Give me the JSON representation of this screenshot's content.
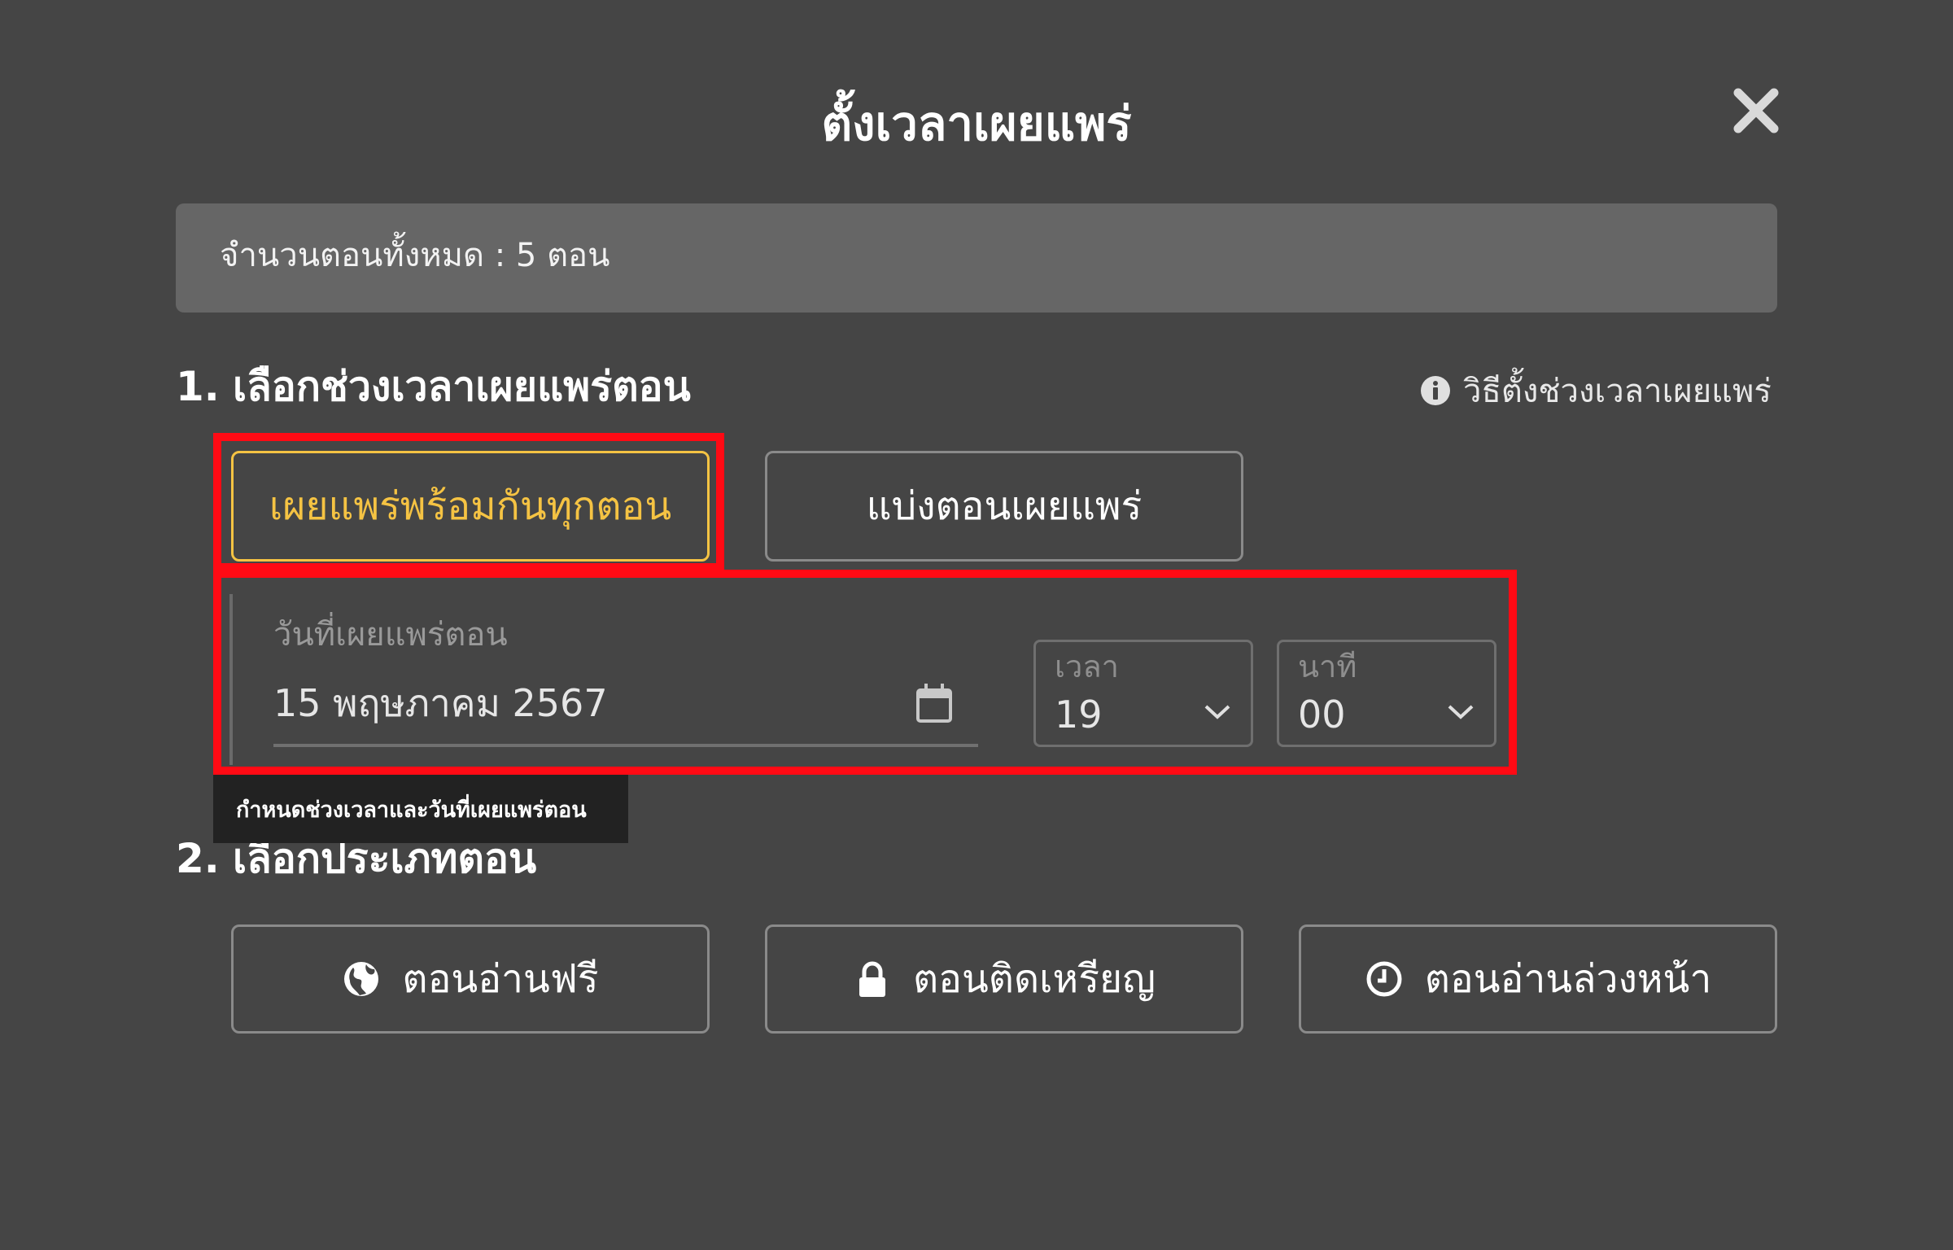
{
  "dialog": {
    "title": "ตั้งเวลาเผยแพร่",
    "close_icon": "close-icon"
  },
  "summary": {
    "text": "จำนวนตอนทั้งหมด : 5 ตอน"
  },
  "section1": {
    "number": "1.",
    "title": "เลือกช่วงเวลาเผยแพร่ตอน",
    "help_link": "วิธีตั้งช่วงเวลาเผยแพร่",
    "help_icon": "info-icon",
    "options": [
      {
        "label": "เผยแพร่พร้อมกันทุกตอน",
        "selected": true
      },
      {
        "label": "แบ่งตอนเผยแพร่",
        "selected": false
      }
    ],
    "date_field": {
      "label": "วันที่เผยแพร่ตอน",
      "value": "15 พฤษภาคม 2567",
      "icon": "calendar-icon"
    },
    "hour_select": {
      "label": "เวลา",
      "value": "19"
    },
    "minute_select": {
      "label": "นาที",
      "value": "00"
    },
    "tooltip": "กำหนดช่วงเวลาและวันที่เผยแพร่ตอน"
  },
  "section2": {
    "number": "2.",
    "title": "เลือกประเภทตอน",
    "types": [
      {
        "label": "ตอนอ่านฟรี",
        "icon": "globe-icon"
      },
      {
        "label": "ตอนติดเหรียญ",
        "icon": "lock-icon"
      },
      {
        "label": "ตอนอ่านล่วงหน้า",
        "icon": "clock-icon"
      }
    ]
  },
  "colors": {
    "background": "#454545",
    "summary_bar": "#666666",
    "selected_accent": "#f5c343",
    "highlight_red": "#ff0a14",
    "tooltip_bg": "#222222"
  }
}
